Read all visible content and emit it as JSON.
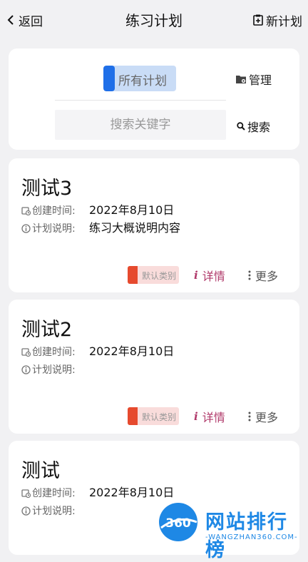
{
  "header": {
    "back_label": "返回",
    "title": "练习计划",
    "new_plan_label": "新计划"
  },
  "search_panel": {
    "filter_label": "所有计划",
    "manage_label": "管理",
    "search_placeholder": "搜索关键字",
    "search_value": "",
    "search_button_label": "搜索"
  },
  "field_labels": {
    "created": "创建时间:",
    "description": "计划说明:"
  },
  "plans": [
    {
      "name": "测试3",
      "created": "2022年8月10日",
      "description": "练习大概说明内容",
      "category": "默认类别",
      "detail_label": "详情",
      "more_label": "更多"
    },
    {
      "name": "测试2",
      "created": "2022年8月10日",
      "description": "",
      "category": "默认类别",
      "detail_label": "详情",
      "more_label": "更多"
    },
    {
      "name": "测试",
      "created": "2022年8月10日",
      "description": "",
      "category": "",
      "detail_label": "",
      "more_label": ""
    }
  ],
  "watermark": {
    "text": "网站排行榜",
    "sub": "-WANGZHAN360.COM-",
    "logo_text": "360"
  },
  "colors": {
    "accent_blue": "#1f6fe8",
    "filter_bg": "#c9dcf6",
    "category_red": "#e64a2e",
    "category_bg": "#f9dcdb",
    "detail_color": "#b0396a"
  }
}
